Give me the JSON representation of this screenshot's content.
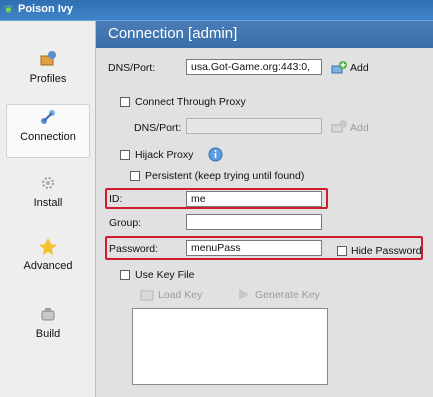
{
  "window": {
    "title": "Poison Ivy"
  },
  "sidebar": {
    "items": [
      {
        "label": "Profiles",
        "icon": "profiles-icon"
      },
      {
        "label": "Connection",
        "icon": "connection-icon",
        "active": true
      },
      {
        "label": "Install",
        "icon": "install-icon"
      },
      {
        "label": "Advanced",
        "icon": "advanced-icon"
      },
      {
        "label": "Build",
        "icon": "build-icon"
      }
    ]
  },
  "header": {
    "title": "Connection [admin]"
  },
  "form": {
    "dns_port_label": "DNS/Port:",
    "dns_port_value": "usa.Got-Game.org:443:0,",
    "add_label": "Add",
    "connect_through_proxy_label": "Connect Through Proxy",
    "proxy_dns_port_label": "DNS/Port:",
    "proxy_dns_port_value": "",
    "proxy_add_label": "Add",
    "hijack_proxy_label": "Hijack Proxy",
    "persistent_label": "Persistent (keep trying until found)",
    "id_label": "ID:",
    "id_value": "me",
    "group_label": "Group:",
    "group_value": "",
    "password_label": "Password:",
    "password_value": "menuPass",
    "hide_password_label": "Hide Password",
    "use_key_file_label": "Use Key File",
    "load_key_label": "Load Key",
    "generate_key_label": "Generate Key"
  },
  "colors": {
    "header_blue": "#3a6ea8",
    "highlight_red": "#d11c2e",
    "title_bar": "#2f6fb1"
  }
}
